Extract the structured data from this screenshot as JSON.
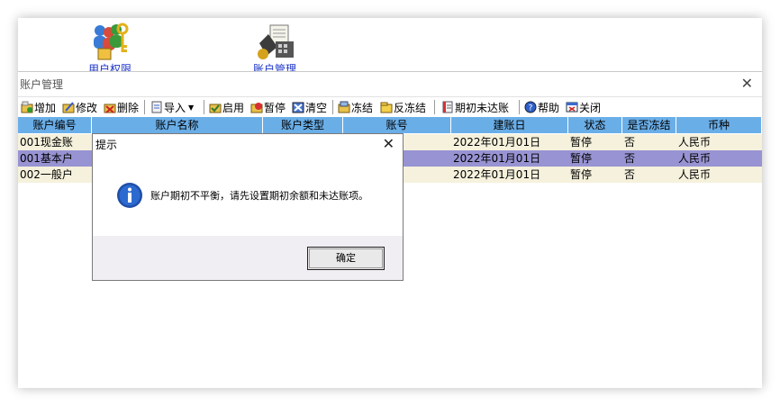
{
  "top_icons": [
    {
      "label": "用户权限",
      "icon": "user-permissions-icon"
    },
    {
      "label": "账户管理",
      "icon": "account-management-icon"
    }
  ],
  "panel": {
    "title": "账户管理"
  },
  "toolbar": [
    {
      "label": "增加",
      "icon": "add-icon"
    },
    {
      "label": "修改",
      "icon": "edit-icon"
    },
    {
      "label": "删除",
      "icon": "delete-icon"
    },
    {
      "label": "导入",
      "icon": "import-icon",
      "dropdown": true
    },
    {
      "label": "启用",
      "icon": "enable-icon"
    },
    {
      "label": "暂停",
      "icon": "pause-icon"
    },
    {
      "label": "清空",
      "icon": "clear-icon"
    },
    {
      "label": "冻结",
      "icon": "freeze-icon"
    },
    {
      "label": "反冻结",
      "icon": "unfreeze-icon"
    },
    {
      "label": "期初未达账",
      "icon": "opening-balance-icon"
    },
    {
      "label": "帮助",
      "icon": "help-icon"
    },
    {
      "label": "关闭",
      "icon": "close-window-icon"
    }
  ],
  "table": {
    "columns": [
      "账户编号",
      "账户名称",
      "账户类型",
      "账号",
      "建账日",
      "状态",
      "是否冻结",
      "币种"
    ],
    "rows": [
      [
        "001现金账",
        "",
        "",
        "",
        "2022年01月01日",
        "暂停",
        "否",
        "人民币"
      ],
      [
        "001基本户",
        "",
        "",
        "",
        "2022年01月01日",
        "暂停",
        "否",
        "人民币"
      ],
      [
        "002一般户",
        "",
        "",
        "",
        "2022年01月01日",
        "暂停",
        "否",
        "人民币"
      ]
    ]
  },
  "dialog": {
    "title": "提示",
    "message": "账户期初不平衡，请先设置期初余额和未达账项。",
    "ok_label": "确定"
  },
  "colors": {
    "header_bg": "#6aaee8",
    "row_normal": "#f5f1dc",
    "row_selected": "#9893d2",
    "link_blue": "#1a33c8"
  }
}
